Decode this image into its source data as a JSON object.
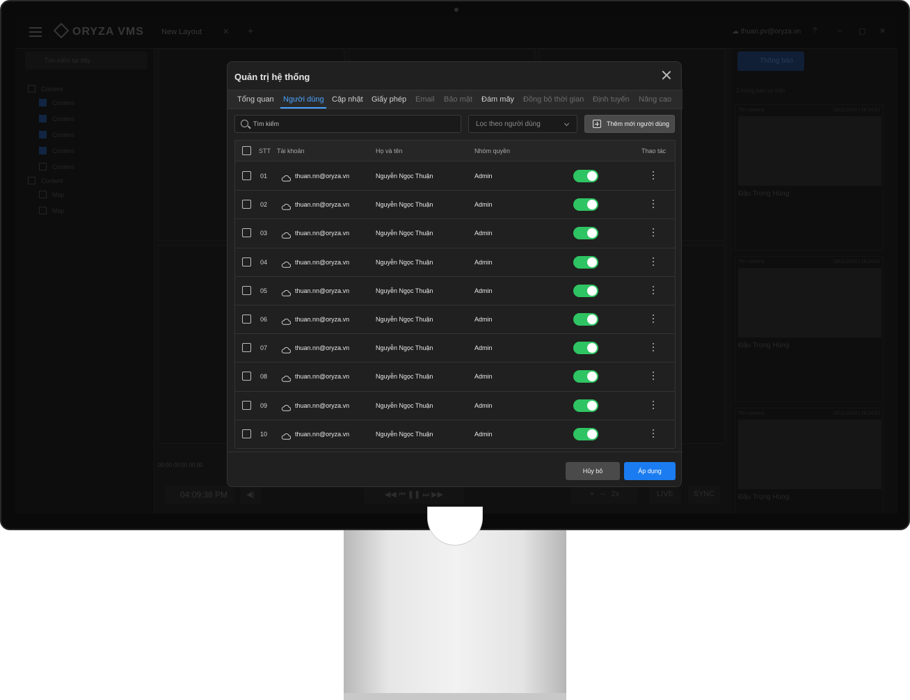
{
  "background": {
    "app_name": "ORYZA VMS",
    "layout_tab": "New Layout",
    "user_email": "thuan.pv@oryza.vn",
    "sidebar_search_placeholder": "Tìm kiếm tại đây",
    "sidebar_items": [
      {
        "label": "Content",
        "checked": false,
        "group": true
      },
      {
        "label": "Content",
        "checked": true
      },
      {
        "label": "Content",
        "checked": true
      },
      {
        "label": "Content",
        "checked": true
      },
      {
        "label": "Content",
        "checked": true
      },
      {
        "label": "Content",
        "checked": false
      },
      {
        "label": "Content",
        "checked": false,
        "group": true
      },
      {
        "label": "Map",
        "checked": false
      },
      {
        "label": "Map",
        "checked": false
      }
    ],
    "playback_time": "04:09:38 PM",
    "time_ticks": "00:00      00:00      00:00",
    "live_label": "LIVE",
    "sync_label": "SYNC",
    "speed_label": "2x",
    "notification_button": "Thông báo",
    "notification_count": "2 thông báo sự kiện",
    "cards": [
      {
        "camera": "Tên camera",
        "date": "28/11/2024 | 08:24:01",
        "name": "Đậu Trọng Hùng"
      },
      {
        "camera": "Tên camera",
        "date": "28/11/2024 | 08:24:01",
        "name": "Đậu Trọng Hùng"
      },
      {
        "camera": "Tên camera",
        "date": "28/11/2024 | 08:24:01",
        "name": "Đậu Trọng Hùng"
      }
    ]
  },
  "modal": {
    "title": "Quản trị hệ thống",
    "tabs": [
      {
        "label": "Tổng quan",
        "state": "normal"
      },
      {
        "label": "Người dùng",
        "state": "active"
      },
      {
        "label": "Cập nhật",
        "state": "normal"
      },
      {
        "label": "Giấy phép",
        "state": "normal"
      },
      {
        "label": "Email",
        "state": "muted"
      },
      {
        "label": "Bảo mật",
        "state": "muted"
      },
      {
        "label": "Đám mây",
        "state": "normal"
      },
      {
        "label": "Đồng bộ thời gian",
        "state": "muted"
      },
      {
        "label": "Định tuyến",
        "state": "muted"
      },
      {
        "label": "Nâng cao",
        "state": "muted"
      }
    ],
    "search_placeholder": "Tìm kiếm",
    "filter_label": "Lọc theo người dùng",
    "add_user_label": "Thêm mới người dùng",
    "table": {
      "headers": {
        "stt": "STT",
        "account": "Tài khoản",
        "fullname": "Họ và tên",
        "role": "Nhóm quyền",
        "actions": "Thao tác"
      },
      "rows": [
        {
          "stt": "01",
          "account": "thuan.nn@oryza.vn",
          "fullname": "Nguyễn Ngọc Thuận",
          "role": "Admin",
          "enabled": true
        },
        {
          "stt": "02",
          "account": "thuan.nn@oryza.vn",
          "fullname": "Nguyễn Ngọc Thuận",
          "role": "Admin",
          "enabled": true
        },
        {
          "stt": "03",
          "account": "thuan.nn@oryza.vn",
          "fullname": "Nguyễn Ngọc Thuận",
          "role": "Admin",
          "enabled": true
        },
        {
          "stt": "04",
          "account": "thuan.nn@oryza.vn",
          "fullname": "Nguyễn Ngọc Thuận",
          "role": "Admin",
          "enabled": true
        },
        {
          "stt": "05",
          "account": "thuan.nn@oryza.vn",
          "fullname": "Nguyễn Ngọc Thuận",
          "role": "Admin",
          "enabled": true
        },
        {
          "stt": "06",
          "account": "thuan.nn@oryza.vn",
          "fullname": "Nguyễn Ngọc Thuận",
          "role": "Admin",
          "enabled": true
        },
        {
          "stt": "07",
          "account": "thuan.nn@oryza.vn",
          "fullname": "Nguyễn Ngọc Thuận",
          "role": "Admin",
          "enabled": true
        },
        {
          "stt": "08",
          "account": "thuan.nn@oryza.vn",
          "fullname": "Nguyễn Ngọc Thuận",
          "role": "Admin",
          "enabled": true
        },
        {
          "stt": "09",
          "account": "thuan.nn@oryza.vn",
          "fullname": "Nguyễn Ngọc Thuận",
          "role": "Admin",
          "enabled": true
        },
        {
          "stt": "10",
          "account": "thuan.nn@oryza.vn",
          "fullname": "Nguyễn Ngọc Thuận",
          "role": "Admin",
          "enabled": true
        }
      ]
    },
    "cancel_label": "Hủy bỏ",
    "apply_label": "Áp dụng"
  },
  "colors": {
    "accent": "#1a7cf0",
    "active_tab": "#4aa3ff",
    "toggle_on": "#2fc463",
    "modal_bg": "#202020"
  }
}
